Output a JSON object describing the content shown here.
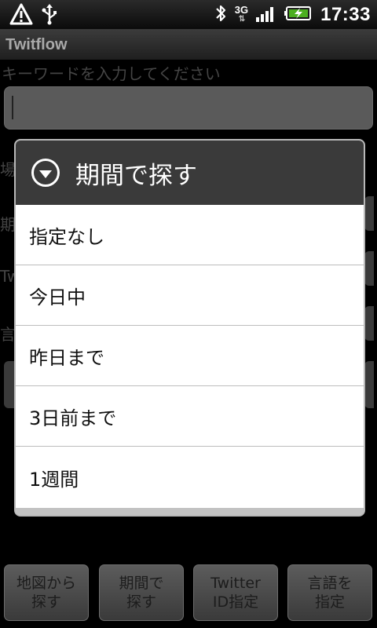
{
  "status_bar": {
    "network": "3G",
    "time": "17:33",
    "icons": [
      "warning-icon",
      "usb-icon",
      "bluetooth-icon",
      "signal-icon",
      "battery-charging-icon"
    ]
  },
  "app": {
    "title": "Twitflow"
  },
  "background_form": {
    "keyword_label": "キーワードを入力してください",
    "keyword_value": "",
    "row_labels": [
      "場",
      "期",
      "Tw",
      "言"
    ]
  },
  "dialog": {
    "title": "期間で探す",
    "icon": "chevron-down-circle-icon",
    "options": [
      {
        "label": "指定なし"
      },
      {
        "label": "今日中"
      },
      {
        "label": "昨日まで"
      },
      {
        "label": "3日前まで"
      },
      {
        "label": "1週間"
      }
    ]
  },
  "bottom_bar": {
    "buttons": [
      {
        "label": "地図から\n探す"
      },
      {
        "label": "期間で\n探す"
      },
      {
        "label": "Twitter\nID指定"
      },
      {
        "label": "言語を\n指定"
      }
    ]
  }
}
